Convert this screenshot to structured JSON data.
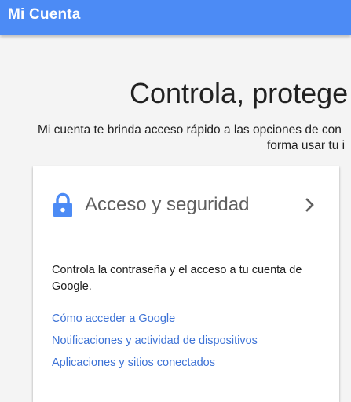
{
  "header": {
    "title": "Mi Cuenta"
  },
  "hero": {
    "title": "Controla, protege",
    "subtitle_line1": "Mi cuenta te brinda acceso rápido a las opciones de con",
    "subtitle_line2": "forma usar tu i"
  },
  "security_card": {
    "icon": "lock-icon",
    "title": "Acceso y seguridad",
    "chevron": "chevron-right-icon",
    "description": "Controla la contraseña y el acceso a tu cuenta de Google.",
    "links": [
      {
        "label": "Cómo acceder a Google"
      },
      {
        "label": "Notificaciones y actividad de dispositivos"
      },
      {
        "label": "Aplicaciones y sitios conectados"
      }
    ]
  },
  "colors": {
    "header_bg": "#4c8bf5",
    "icon_blue": "#4c8bf5",
    "link": "#3e73d6",
    "page_bg": "#f4f4f4"
  }
}
